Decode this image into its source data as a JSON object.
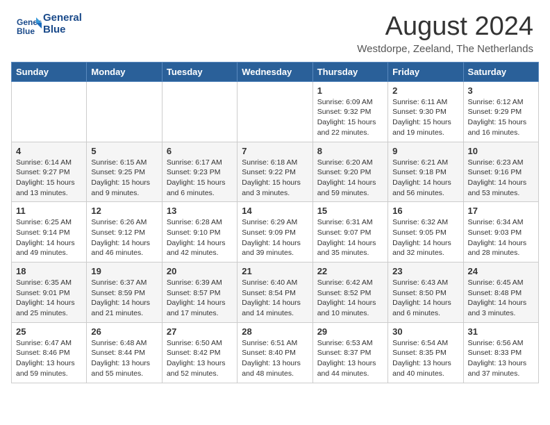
{
  "header": {
    "logo_line1": "General",
    "logo_line2": "Blue",
    "month_title": "August 2024",
    "subtitle": "Westdorpe, Zeeland, The Netherlands"
  },
  "weekdays": [
    "Sunday",
    "Monday",
    "Tuesday",
    "Wednesday",
    "Thursday",
    "Friday",
    "Saturday"
  ],
  "weeks": [
    [
      {
        "day": "",
        "info": ""
      },
      {
        "day": "",
        "info": ""
      },
      {
        "day": "",
        "info": ""
      },
      {
        "day": "",
        "info": ""
      },
      {
        "day": "1",
        "info": "Sunrise: 6:09 AM\nSunset: 9:32 PM\nDaylight: 15 hours and 22 minutes."
      },
      {
        "day": "2",
        "info": "Sunrise: 6:11 AM\nSunset: 9:30 PM\nDaylight: 15 hours and 19 minutes."
      },
      {
        "day": "3",
        "info": "Sunrise: 6:12 AM\nSunset: 9:29 PM\nDaylight: 15 hours and 16 minutes."
      }
    ],
    [
      {
        "day": "4",
        "info": "Sunrise: 6:14 AM\nSunset: 9:27 PM\nDaylight: 15 hours and 13 minutes."
      },
      {
        "day": "5",
        "info": "Sunrise: 6:15 AM\nSunset: 9:25 PM\nDaylight: 15 hours and 9 minutes."
      },
      {
        "day": "6",
        "info": "Sunrise: 6:17 AM\nSunset: 9:23 PM\nDaylight: 15 hours and 6 minutes."
      },
      {
        "day": "7",
        "info": "Sunrise: 6:18 AM\nSunset: 9:22 PM\nDaylight: 15 hours and 3 minutes."
      },
      {
        "day": "8",
        "info": "Sunrise: 6:20 AM\nSunset: 9:20 PM\nDaylight: 14 hours and 59 minutes."
      },
      {
        "day": "9",
        "info": "Sunrise: 6:21 AM\nSunset: 9:18 PM\nDaylight: 14 hours and 56 minutes."
      },
      {
        "day": "10",
        "info": "Sunrise: 6:23 AM\nSunset: 9:16 PM\nDaylight: 14 hours and 53 minutes."
      }
    ],
    [
      {
        "day": "11",
        "info": "Sunrise: 6:25 AM\nSunset: 9:14 PM\nDaylight: 14 hours and 49 minutes."
      },
      {
        "day": "12",
        "info": "Sunrise: 6:26 AM\nSunset: 9:12 PM\nDaylight: 14 hours and 46 minutes."
      },
      {
        "day": "13",
        "info": "Sunrise: 6:28 AM\nSunset: 9:10 PM\nDaylight: 14 hours and 42 minutes."
      },
      {
        "day": "14",
        "info": "Sunrise: 6:29 AM\nSunset: 9:09 PM\nDaylight: 14 hours and 39 minutes."
      },
      {
        "day": "15",
        "info": "Sunrise: 6:31 AM\nSunset: 9:07 PM\nDaylight: 14 hours and 35 minutes."
      },
      {
        "day": "16",
        "info": "Sunrise: 6:32 AM\nSunset: 9:05 PM\nDaylight: 14 hours and 32 minutes."
      },
      {
        "day": "17",
        "info": "Sunrise: 6:34 AM\nSunset: 9:03 PM\nDaylight: 14 hours and 28 minutes."
      }
    ],
    [
      {
        "day": "18",
        "info": "Sunrise: 6:35 AM\nSunset: 9:01 PM\nDaylight: 14 hours and 25 minutes."
      },
      {
        "day": "19",
        "info": "Sunrise: 6:37 AM\nSunset: 8:59 PM\nDaylight: 14 hours and 21 minutes."
      },
      {
        "day": "20",
        "info": "Sunrise: 6:39 AM\nSunset: 8:57 PM\nDaylight: 14 hours and 17 minutes."
      },
      {
        "day": "21",
        "info": "Sunrise: 6:40 AM\nSunset: 8:54 PM\nDaylight: 14 hours and 14 minutes."
      },
      {
        "day": "22",
        "info": "Sunrise: 6:42 AM\nSunset: 8:52 PM\nDaylight: 14 hours and 10 minutes."
      },
      {
        "day": "23",
        "info": "Sunrise: 6:43 AM\nSunset: 8:50 PM\nDaylight: 14 hours and 6 minutes."
      },
      {
        "day": "24",
        "info": "Sunrise: 6:45 AM\nSunset: 8:48 PM\nDaylight: 14 hours and 3 minutes."
      }
    ],
    [
      {
        "day": "25",
        "info": "Sunrise: 6:47 AM\nSunset: 8:46 PM\nDaylight: 13 hours and 59 minutes."
      },
      {
        "day": "26",
        "info": "Sunrise: 6:48 AM\nSunset: 8:44 PM\nDaylight: 13 hours and 55 minutes."
      },
      {
        "day": "27",
        "info": "Sunrise: 6:50 AM\nSunset: 8:42 PM\nDaylight: 13 hours and 52 minutes."
      },
      {
        "day": "28",
        "info": "Sunrise: 6:51 AM\nSunset: 8:40 PM\nDaylight: 13 hours and 48 minutes."
      },
      {
        "day": "29",
        "info": "Sunrise: 6:53 AM\nSunset: 8:37 PM\nDaylight: 13 hours and 44 minutes."
      },
      {
        "day": "30",
        "info": "Sunrise: 6:54 AM\nSunset: 8:35 PM\nDaylight: 13 hours and 40 minutes."
      },
      {
        "day": "31",
        "info": "Sunrise: 6:56 AM\nSunset: 8:33 PM\nDaylight: 13 hours and 37 minutes."
      }
    ]
  ]
}
